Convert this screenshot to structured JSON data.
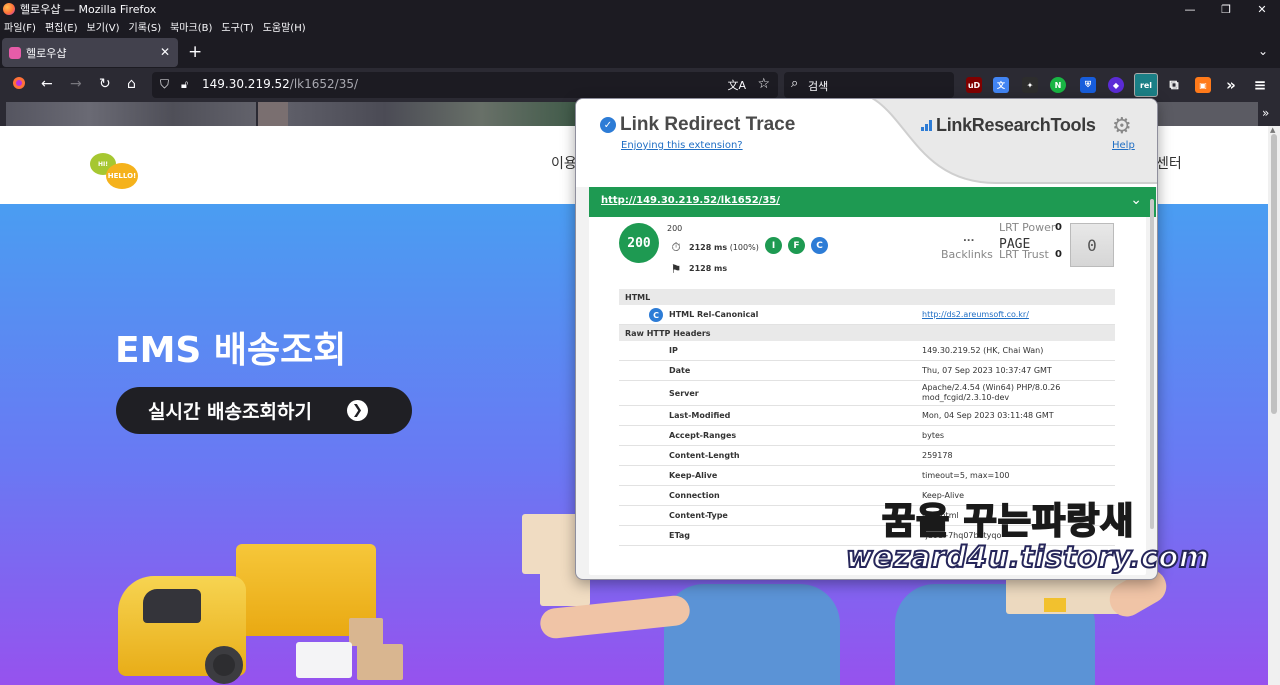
{
  "window": {
    "title": "헬로우샵 — Mozilla Firefox",
    "controls": {
      "minimize": "—",
      "restore": "❐",
      "close": "✕"
    }
  },
  "menu": [
    "파일(F)",
    "편집(E)",
    "보기(V)",
    "기록(S)",
    "북마크(B)",
    "도구(T)",
    "도움말(H)"
  ],
  "tab": {
    "title": "헬로우샵",
    "close": "✕",
    "new_tab": "+",
    "list": "⌄"
  },
  "nav": {
    "url_host": "149.30.219.52",
    "url_path": "/lk1652/35/",
    "search_placeholder": "검색",
    "icons": [
      "firefox-view-icon",
      "back-icon",
      "forward-icon",
      "reload-icon",
      "home-icon",
      "shield-icon",
      "lock-icon",
      "translate-icon",
      "star-icon",
      "search-icon"
    ]
  },
  "extensions": [
    {
      "name": "ublock-icon",
      "label": "uD",
      "color": "#800000"
    },
    {
      "name": "translate-ext-icon",
      "label": "文",
      "color": "#4285f4"
    },
    {
      "name": "puzzle-green-icon",
      "label": "✦",
      "color": "#2d2d2d"
    },
    {
      "name": "n-icon",
      "label": "N",
      "color": "#19b544"
    },
    {
      "name": "bitwarden-icon",
      "label": "⛨",
      "color": "#175ddc"
    },
    {
      "name": "purple-shield-icon",
      "label": "◆",
      "color": "#5b2bd6"
    },
    {
      "name": "rel-icon",
      "label": "rel",
      "color": "#1b7f86"
    },
    {
      "name": "extensions-icon",
      "label": "⧉",
      "color": "#2b2a33"
    },
    {
      "name": "orange-ext-icon",
      "label": "▣",
      "color": "#ff7a1a"
    },
    {
      "name": "overflow-icon",
      "label": "»",
      "color": "#2b2a33"
    },
    {
      "name": "menu-icon",
      "label": "≡",
      "color": "#2b2a33"
    }
  ],
  "site": {
    "logo_small": "HI!",
    "logo_large": "HELLO!",
    "nav_left": "이용",
    "nav_right": "센터",
    "hero_title": "EMS 배송조회",
    "hero_button": "실시간 배송조회하기",
    "hero_button_arrow": "❯"
  },
  "popup": {
    "title": "Link Redirect Trace",
    "enjoy": "Enjoying this extension?",
    "brand": "LinkResearchTools",
    "help": "Help",
    "url": "http://149.30.219.52/lk1652/35/",
    "status_code": "200",
    "status_small": "200",
    "time_total": "2128 ms",
    "time_pct": "(100%)",
    "time_final": "2128 ms",
    "badges": [
      {
        "label": "I",
        "color": "#1e9a52"
      },
      {
        "label": "F",
        "color": "#1e9a52"
      },
      {
        "label": "C",
        "color": "#2d7cd6"
      }
    ],
    "lrt_power_label": "LRT Power",
    "lrt_power_value": "0",
    "lrt_trust_label": "LRT Trust",
    "lrt_trust_value": "0",
    "backlinks_value": "...",
    "backlinks_label": "Backlinks",
    "page_label": "PAGE",
    "score": "0",
    "html_section": "HTML",
    "canonical_label": "HTML Rel-Canonical",
    "canonical_value": "http://ds2.areumsoft.co.kr/",
    "headers_section": "Raw HTTP Headers",
    "headers": [
      {
        "k": "IP",
        "v": "149.30.219.52 (HK, Chai Wan)"
      },
      {
        "k": "Date",
        "v": "Thu, 07 Sep 2023 10:37:47 GMT"
      },
      {
        "k": "Server",
        "v": "Apache/2.4.54 (Win64) PHP/8.0.26 mod_fcgid/2.3.10-dev"
      },
      {
        "k": "Last-Modified",
        "v": "Mon, 04 Sep 2023 03:11:48 GMT"
      },
      {
        "k": "Accept-Ranges",
        "v": "bytes"
      },
      {
        "k": "Content-Length",
        "v": "259178"
      },
      {
        "k": "Keep-Alive",
        "v": "timeout=5, max=100"
      },
      {
        "k": "Connection",
        "v": "Keep-Alive"
      },
      {
        "k": "Content-Type",
        "v": "text/html"
      },
      {
        "k": "ETag",
        "v": "\"ja0dl-7hq07betyqo\""
      }
    ]
  },
  "watermark": {
    "line1": "꿈을 꾸는파랑새",
    "line2": "wezard4u.tistory.com"
  }
}
